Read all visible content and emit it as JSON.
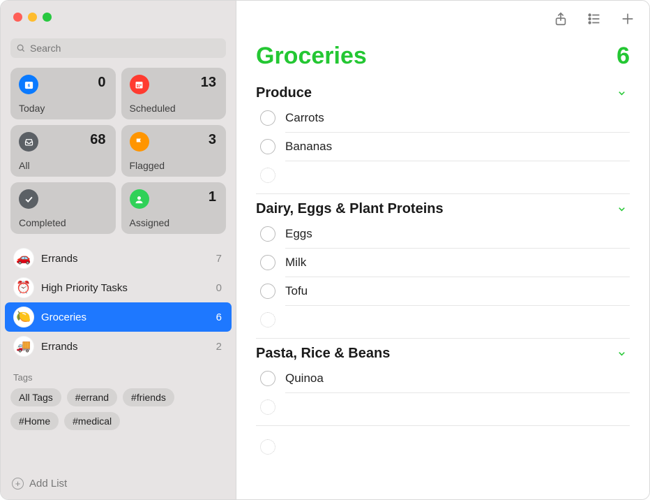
{
  "search": {
    "placeholder": "Search"
  },
  "smart": {
    "today": {
      "label": "Today",
      "count": "0",
      "color": "#0a7aff"
    },
    "scheduled": {
      "label": "Scheduled",
      "count": "13",
      "color": "#ff3b30"
    },
    "all": {
      "label": "All",
      "count": "68",
      "color": "#5b6065"
    },
    "flagged": {
      "label": "Flagged",
      "count": "3",
      "color": "#ff9500"
    },
    "completed": {
      "label": "Completed",
      "count": "",
      "color": "#5b6065"
    },
    "assigned": {
      "label": "Assigned",
      "count": "1",
      "color": "#30d158"
    }
  },
  "lists": [
    {
      "icon": "🚗",
      "name": "Errands",
      "count": "7",
      "selected": false
    },
    {
      "icon": "⏰",
      "name": "High Priority Tasks",
      "count": "0",
      "selected": false
    },
    {
      "icon": "🍋",
      "name": "Groceries",
      "count": "6",
      "selected": true
    },
    {
      "icon": "🚚",
      "name": "Errands",
      "count": "2",
      "selected": false
    }
  ],
  "tags": {
    "header": "Tags",
    "items": [
      "All Tags",
      "#errand",
      "#friends",
      "#Home",
      "#medical"
    ]
  },
  "addList": {
    "label": "Add List"
  },
  "main": {
    "title": "Groceries",
    "count": "6",
    "accent": "#24c733",
    "sections": [
      {
        "name": "Produce",
        "items": [
          "Carrots",
          "Bananas"
        ]
      },
      {
        "name": "Dairy, Eggs & Plant Proteins",
        "items": [
          "Eggs",
          "Milk",
          "Tofu"
        ]
      },
      {
        "name": "Pasta, Rice & Beans",
        "items": [
          "Quinoa"
        ]
      }
    ]
  }
}
